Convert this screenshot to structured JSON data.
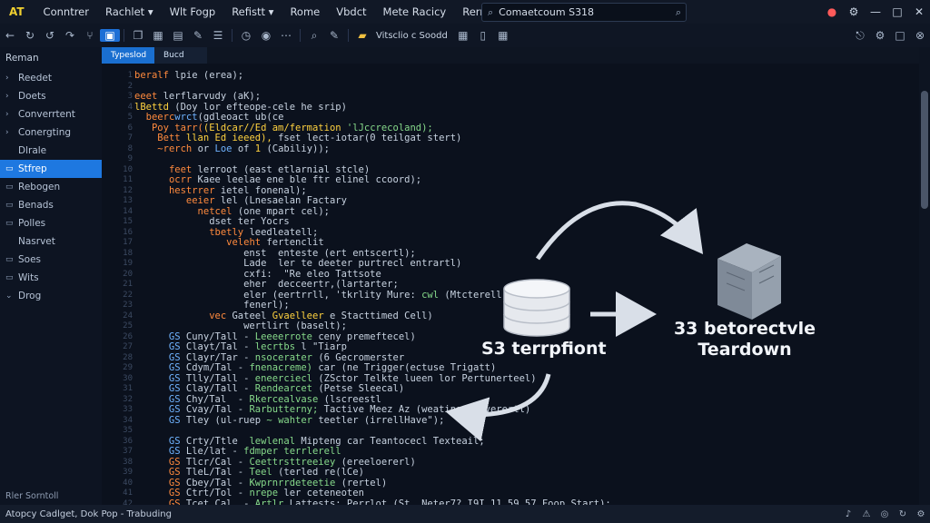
{
  "menubar": {
    "logo": "AT",
    "items": [
      "Conntrer",
      "Rachlet",
      "Wlt Fogp",
      "Refistt",
      "Rome",
      "Vbdct",
      "Mete Racicy",
      "Rerrerfertie"
    ],
    "search_text": "Comaetcoum S318"
  },
  "toolbar": {
    "label": "Vitsclio c Soodd"
  },
  "sidebar": {
    "header": "Reman",
    "items": [
      {
        "label": "Reedet",
        "icon": "chevron-right-icon"
      },
      {
        "label": "Doets",
        "icon": "chevron-right-icon"
      },
      {
        "label": "Converrtent",
        "icon": "chevron-right-icon"
      },
      {
        "label": "Conergting",
        "icon": "chevron-right-icon"
      },
      {
        "label": "Dlrale",
        "icon": ""
      },
      {
        "label": "Stfrep",
        "icon": "folder-icon",
        "selected": true
      },
      {
        "label": "Rebogen",
        "icon": "folder-icon"
      },
      {
        "label": "Benads",
        "icon": "folder-icon"
      },
      {
        "label": "Polles",
        "icon": "folder-icon"
      },
      {
        "label": "Nasrvet",
        "icon": ""
      },
      {
        "label": "Soes",
        "icon": "folder-icon"
      },
      {
        "label": "Wits",
        "icon": "folder-icon"
      },
      {
        "label": "Drog",
        "icon": "chevron-down-icon"
      }
    ],
    "footer": "Rler Sorntoll"
  },
  "tabs": [
    {
      "label": "Typeslod",
      "active": true
    },
    {
      "label": "Bucd",
      "active": false
    }
  ],
  "code": {
    "lines": [
      [
        [
          "kw",
          "beralf "
        ],
        [
          "cm",
          "lpie (erea);"
        ]
      ],
      [
        [
          "cm",
          ""
        ]
      ],
      [
        [
          "kw",
          "eeet "
        ],
        [
          "cm",
          "lerflarvudy (aK);"
        ]
      ],
      [
        [
          "fn",
          "lBettd "
        ],
        [
          "cm",
          "(Doy lor efteope-cele he srip)"
        ]
      ],
      [
        [
          "cm",
          "  "
        ],
        [
          "kw",
          "beerc"
        ],
        [
          "nm",
          "wrct"
        ],
        [
          "cm",
          "(gdleoact ub(ce"
        ]
      ],
      [
        [
          "cm",
          "   "
        ],
        [
          "kw",
          "Poy tarr("
        ],
        [
          "fn",
          "(Eldcar//Ed am/fermation "
        ],
        [
          "str",
          "'lJccrecoland);"
        ]
      ],
      [
        [
          "cm",
          "    "
        ],
        [
          "kw",
          "Bett "
        ],
        [
          "fn",
          "llan Ed ieeed), "
        ],
        [
          "cm",
          "fset lect-iotar(0 teilgat stert)"
        ]
      ],
      [
        [
          "cm",
          "    "
        ],
        [
          "kw",
          "~rerch "
        ],
        [
          "cm",
          "or "
        ],
        [
          "nm",
          "Loe "
        ],
        [
          "cm",
          "of "
        ],
        [
          "fn",
          "1 "
        ],
        [
          "cm",
          "(Cabiliy));"
        ]
      ],
      [
        [
          "cm",
          ""
        ]
      ],
      [
        [
          "cm",
          "      "
        ],
        [
          "kw",
          "feet "
        ],
        [
          "cm",
          "lerroot (east etlarnial stcle)"
        ]
      ],
      [
        [
          "cm",
          "      "
        ],
        [
          "kw",
          "ocrr "
        ],
        [
          "cm",
          "Kaee leelae ene ble ftr elinel ccoord);"
        ]
      ],
      [
        [
          "cm",
          "      "
        ],
        [
          "kw",
          "hestrrer "
        ],
        [
          "cm",
          "ietel fonenal);"
        ]
      ],
      [
        [
          "cm",
          "         "
        ],
        [
          "kw",
          "eeier "
        ],
        [
          "cm",
          "lel (Lnesaelan Factary"
        ]
      ],
      [
        [
          "cm",
          "           "
        ],
        [
          "kw",
          "netcel "
        ],
        [
          "cm",
          "(one mpart cel);"
        ]
      ],
      [
        [
          "cm",
          "             "
        ],
        [
          "cm",
          "dset ter Yocrs"
        ]
      ],
      [
        [
          "cm",
          "             "
        ],
        [
          "kw",
          "tbetly "
        ],
        [
          "cm",
          "leedleatell;"
        ]
      ],
      [
        [
          "cm",
          "                "
        ],
        [
          "kw",
          "veleht "
        ],
        [
          "cm",
          "fertenclit"
        ]
      ],
      [
        [
          "cm",
          "                   "
        ],
        [
          "cm",
          "enst  enteste (ert entscertl);"
        ]
      ],
      [
        [
          "cm",
          "                   "
        ],
        [
          "cm",
          "Lade  ler te deeter purtrecl entrartl)"
        ]
      ],
      [
        [
          "cm",
          "                   "
        ],
        [
          "cm",
          "cxfi:  \"Re eleo Tattsote"
        ]
      ],
      [
        [
          "cm",
          "                   "
        ],
        [
          "cm",
          "eher  decceertr,(lartarter;"
        ]
      ],
      [
        [
          "cm",
          "                   "
        ],
        [
          "cm",
          "eler (eertrrll, 'tkrlity "
        ],
        [
          "cm",
          "Mure: "
        ],
        [
          "str",
          "cwl "
        ],
        [
          "cm",
          "(Mtcterell)"
        ]
      ],
      [
        [
          "cm",
          "                   "
        ],
        [
          "cm",
          "fenerl);"
        ]
      ],
      [
        [
          "cm",
          "             "
        ],
        [
          "kw",
          "vec "
        ],
        [
          "cm",
          "Gateel "
        ],
        [
          "fn",
          "Gvaelleer "
        ],
        [
          "cm",
          "e Stacttimed Cell)"
        ]
      ],
      [
        [
          "cm",
          "                   "
        ],
        [
          "cm",
          "wertlirt (baselt);"
        ]
      ],
      [
        [
          "nm",
          "      GS "
        ],
        [
          "cm",
          "Cuny/Tall - "
        ],
        [
          "str",
          "Leeeerrote "
        ],
        [
          "cm",
          "ceny premeftecel)"
        ]
      ],
      [
        [
          "nm",
          "      GS "
        ],
        [
          "cm",
          "Clayt/Tal - "
        ],
        [
          "str",
          "lecrtbs "
        ],
        [
          "cm",
          "l \"Tiarp"
        ]
      ],
      [
        [
          "nm",
          "      GS "
        ],
        [
          "cm",
          "Clayr/Tar - "
        ],
        [
          "str",
          "nsocerater "
        ],
        [
          "cm",
          "(6 Gecromerster"
        ]
      ],
      [
        [
          "nm",
          "      GS "
        ],
        [
          "cm",
          "Cdym/Tal - "
        ],
        [
          "str",
          "fnenacreme) "
        ],
        [
          "cm",
          "car (ne Trigger(ectuse Trigatt)"
        ]
      ],
      [
        [
          "nm",
          "      GS "
        ],
        [
          "cm",
          "Tlly/Tall - "
        ],
        [
          "str",
          "eneerciecl "
        ],
        [
          "cm",
          "(ZSctor Telkte lueen lor Pertunerteel)"
        ]
      ],
      [
        [
          "nm",
          "      GS "
        ],
        [
          "cm",
          "Clay/Tall - "
        ],
        [
          "str",
          "Rendearcet "
        ],
        [
          "cm",
          "(Petse Sleecal)"
        ]
      ],
      [
        [
          "nm",
          "      GS "
        ],
        [
          "cm",
          "Chy/Tal  - "
        ],
        [
          "str",
          "Rkercealvase "
        ],
        [
          "cm",
          "(lscreestl"
        ]
      ],
      [
        [
          "nm",
          "      GS "
        ],
        [
          "cm",
          "Cvay/Tal - "
        ],
        [
          "str",
          "Rarbutterny; "
        ],
        [
          "cm",
          "Tactive Meez Az (weating (vfverertl)"
        ]
      ],
      [
        [
          "nm",
          "      GS "
        ],
        [
          "cm",
          "Tley (ul-ruep "
        ],
        [
          "str",
          "~ wahter "
        ],
        [
          "cm",
          "teetler (irrellHave\");"
        ]
      ],
      [
        [
          "cm",
          ""
        ]
      ],
      [
        [
          "nm",
          "      GS "
        ],
        [
          "cm",
          "Crty/Ttle  "
        ],
        [
          "str",
          "lewlenal "
        ],
        [
          "cm",
          "Mipteng car Teantocecl Texteail;"
        ]
      ],
      [
        [
          "nm",
          "      GS "
        ],
        [
          "cm",
          "Lle/lat - "
        ],
        [
          "str",
          "fdmper terrlerell"
        ]
      ],
      [
        [
          "kw",
          "      GS "
        ],
        [
          "cm",
          "Tlcr/Cal - "
        ],
        [
          "str",
          "Ceettrsttreeiey "
        ],
        [
          "cm",
          "(ereeloererl)"
        ]
      ],
      [
        [
          "kw",
          "      GS "
        ],
        [
          "cm",
          "TleL/Tal - "
        ],
        [
          "str",
          "Teel "
        ],
        [
          "cm",
          "(terled re(lCe)"
        ]
      ],
      [
        [
          "kw",
          "      GS "
        ],
        [
          "cm",
          "Cbey/Tal - "
        ],
        [
          "str",
          "Kwprnrrdeteetie "
        ],
        [
          "cm",
          "(rertel)"
        ]
      ],
      [
        [
          "kw",
          "      GS "
        ],
        [
          "cm",
          "Ctrt/Tol - "
        ],
        [
          "str",
          "nrepe "
        ],
        [
          "cm",
          "ler ceteneoten"
        ]
      ],
      [
        [
          "kw",
          "      GS "
        ],
        [
          "cm",
          "Tcet Cal  - "
        ],
        [
          "str",
          "Artlr "
        ],
        [
          "cm",
          "Lattests: Perrlot (St, Neter7?,I9I,11.59,57 Foop Start);"
        ]
      ],
      [
        [
          "cm",
          ""
        ]
      ],
      [
        [
          "nm",
          "      GS "
        ],
        [
          "cm",
          "Cbr/Tal - "
        ],
        [
          "str",
          "ilvelitter "
        ],
        [
          "cm",
          "al of Peerier anitN)"
        ]
      ]
    ]
  },
  "diagram": {
    "left_label": "S3 terrpfiont",
    "right_label_line1": "33 betorectvle",
    "right_label_line2": "Teardown"
  },
  "status": {
    "left": "Atopcy  Cadlget, Dok Pop - Trabuding"
  }
}
